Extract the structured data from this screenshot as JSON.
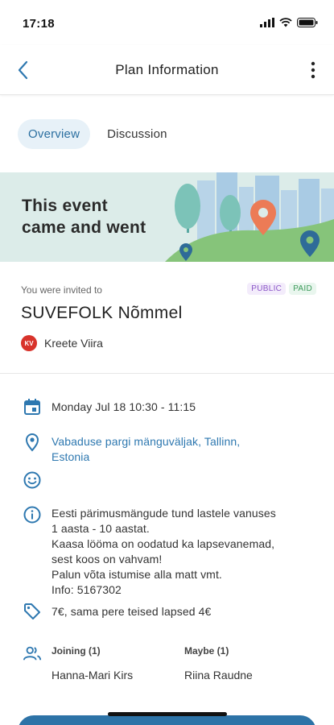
{
  "status_bar": {
    "time": "17:18",
    "icons": [
      "signal-icon",
      "wifi-icon",
      "battery-icon"
    ]
  },
  "nav": {
    "title": "Plan Information",
    "back_icon": "chevron-left-icon",
    "more_icon": "more-vertical-icon"
  },
  "tabs": [
    {
      "label": "Overview",
      "active": true
    },
    {
      "label": "Discussion",
      "active": false
    }
  ],
  "banner": {
    "line1": "This event",
    "line2": "came and went"
  },
  "invite": {
    "label": "You were invited to",
    "badges": [
      "PUBLIC",
      "PAID"
    ],
    "title": "SUVEFOLK Nõmmel",
    "host_initials": "KV",
    "host_name": "Kreete Viira"
  },
  "details": {
    "datetime": "Monday Jul 18 10:30 - 11:15",
    "location_line1": "Vabaduse pargi mänguväljak, Tallinn,",
    "location_line2": "Estonia",
    "description": [
      "Eesti pärimusmängude tund lastele vanuses",
      "1 aasta - 10 aastat.",
      "Kaasa lööma on oodatud ka lapsevanemad,",
      "sest koos on vahvam!",
      "Palun võta istumise alla matt vmt.",
      "Info: 5167302"
    ],
    "price": "7€, sama pere teised lapsed 4€"
  },
  "participants": {
    "joining_header": "Joining (1)",
    "maybe_header": "Maybe (1)",
    "joining": [
      "Hanna-Mari Kirs"
    ],
    "maybe": [
      "Riina Raudne"
    ]
  },
  "colors": {
    "accent": "#2e78b0",
    "banner_bg": "#dcece9",
    "avatar": "#d8332b"
  }
}
